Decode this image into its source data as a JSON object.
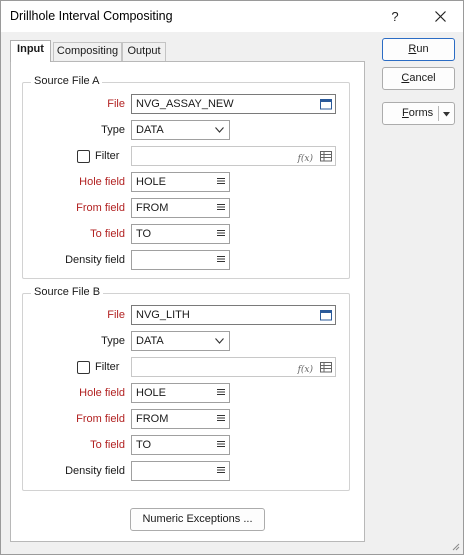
{
  "window": {
    "title": "Drillhole Interval Compositing",
    "help": "?"
  },
  "tabs": [
    {
      "label": "Input",
      "active": true
    },
    {
      "label": "Compositing",
      "active": false
    },
    {
      "label": "Output",
      "active": false
    }
  ],
  "sourceA": {
    "legend": "Source File A",
    "file_label": "File",
    "file_value": "NVG_ASSAY_NEW",
    "type_label": "Type",
    "type_value": "DATA",
    "filter_label": "Filter",
    "filter_value": "",
    "hole_label": "Hole field",
    "hole_value": "HOLE",
    "from_label": "From field",
    "from_value": "FROM",
    "to_label": "To field",
    "to_value": "TO",
    "density_label": "Density field",
    "density_value": ""
  },
  "sourceB": {
    "legend": "Source File B",
    "file_label": "File",
    "file_value": "NVG_LITH",
    "type_label": "Type",
    "type_value": "DATA",
    "filter_label": "Filter",
    "filter_value": "",
    "hole_label": "Hole field",
    "hole_value": "HOLE",
    "from_label": "From field",
    "from_value": "FROM",
    "to_label": "To field",
    "to_value": "TO",
    "density_label": "Density field",
    "density_value": ""
  },
  "buttons": {
    "run_first": "R",
    "run_rest": "un",
    "cancel_first": "C",
    "cancel_rest": "ancel",
    "forms_first": "F",
    "forms_rest": "orms",
    "numeric_exceptions": "Numeric Exceptions ..."
  },
  "fx_symbol": "f(x)",
  "colors": {
    "required_label": "#b22222",
    "primary_border": "#2b6cc4"
  }
}
